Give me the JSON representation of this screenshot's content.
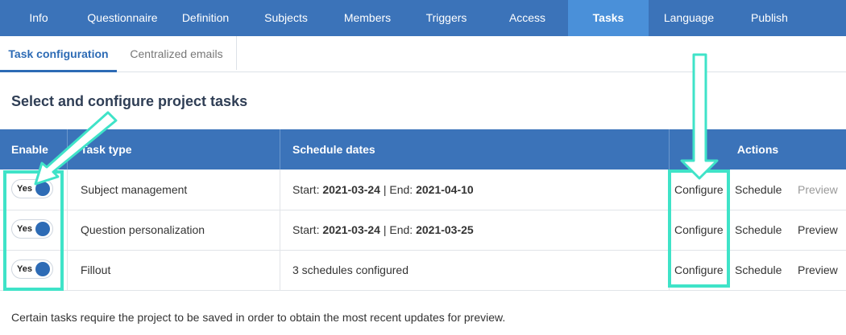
{
  "nav": {
    "tabs": [
      {
        "label": "Info"
      },
      {
        "label": "Questionnaire"
      },
      {
        "label": "Definition"
      },
      {
        "label": "Subjects"
      },
      {
        "label": "Members"
      },
      {
        "label": "Triggers"
      },
      {
        "label": "Access"
      },
      {
        "label": "Tasks",
        "active": true
      },
      {
        "label": "Language"
      },
      {
        "label": "Publish"
      }
    ]
  },
  "subtabs": [
    {
      "label": "Task configuration",
      "active": true
    },
    {
      "label": "Centralized emails"
    }
  ],
  "heading": "Select and configure project tasks",
  "table": {
    "headers": {
      "enable": "Enable",
      "task_type": "Task type",
      "schedule": "Schedule dates",
      "actions": "Actions"
    },
    "rows": [
      {
        "toggle": "Yes",
        "task": "Subject management",
        "start_label": "Start: ",
        "start": "2021-03-24",
        "sep": " | End: ",
        "end": "2021-04-10",
        "configure": "Configure",
        "schedule": "Schedule",
        "preview": "Preview",
        "preview_disabled": true
      },
      {
        "toggle": "Yes",
        "task": "Question personalization",
        "start_label": "Start: ",
        "start": "2021-03-24",
        "sep": " | End: ",
        "end": "2021-03-25",
        "configure": "Configure",
        "schedule": "Schedule",
        "preview": "Preview"
      },
      {
        "toggle": "Yes",
        "task": "Fillout",
        "schedule_text": "3 schedules configured",
        "configure": "Configure",
        "schedule": "Schedule",
        "preview": "Preview"
      }
    ]
  },
  "footer_note": "Certain tasks require the project to be saved in order to obtain the most recent updates for preview.",
  "colors": {
    "nav_bg": "#3b73b9",
    "nav_active": "#4a90d9",
    "highlight": "#3fe3c8",
    "toggle_knob": "#2d6bb5"
  }
}
